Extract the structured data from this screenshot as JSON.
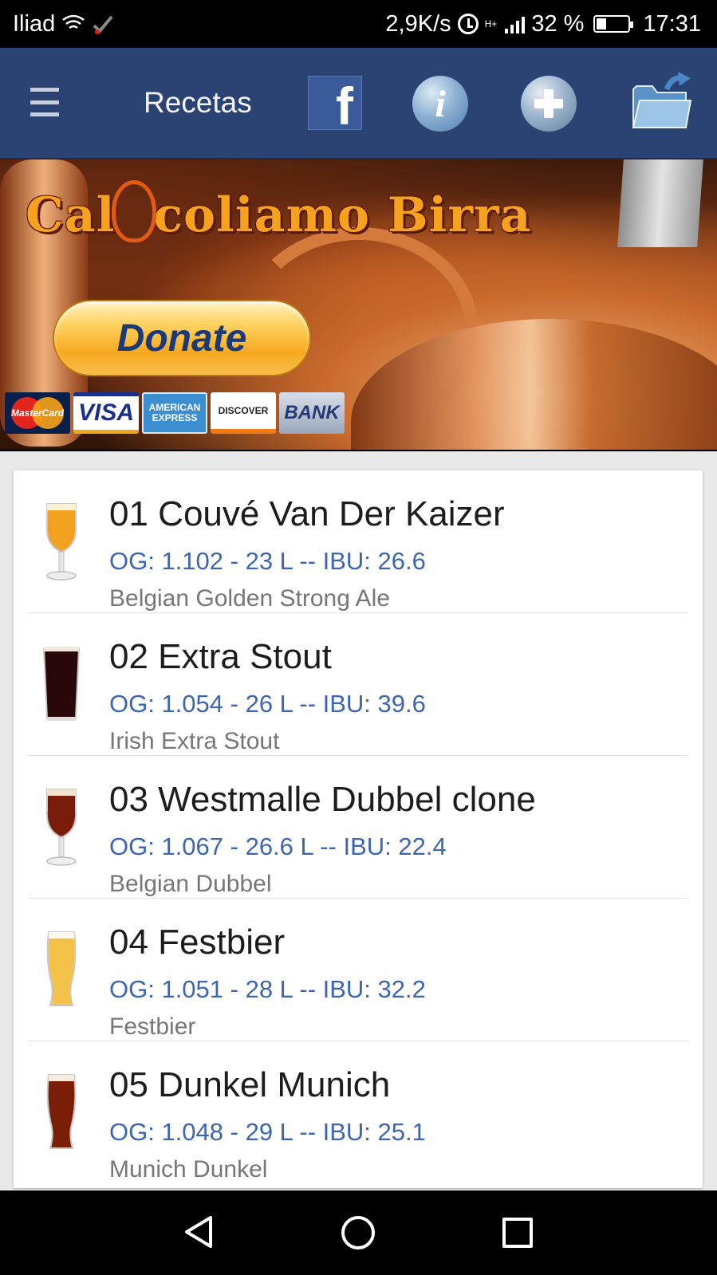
{
  "status_bar": {
    "carrier": "Iliad",
    "network_speed": "2,9K/s",
    "network_type": "H+",
    "battery": "32 %",
    "time": "17:31"
  },
  "app_bar": {
    "title": "Recetas",
    "facebook_glyph": "f",
    "info_glyph": "i"
  },
  "banner": {
    "logo_text": "Cal coliamo Birra",
    "logo_part1": "Cal",
    "logo_part2": "coliamo Birra",
    "donate_label": "Donate",
    "cards": {
      "mastercard": "MasterCard",
      "visa": "VISA",
      "amex": "AMERICAN EXPRESS",
      "discover": "DISCOVER",
      "bank": "BANK"
    }
  },
  "recipes": [
    {
      "name": "01 Couvé Van Der Kaizer",
      "stats": "OG: 1.102 - 23 L -- IBU: 26.6",
      "style": "Belgian Golden Strong Ale",
      "glass": "tulip",
      "color": "#f2a020"
    },
    {
      "name": "02 Extra Stout",
      "stats": "OG: 1.054 - 26 L -- IBU: 39.6",
      "style": "Irish Extra Stout",
      "glass": "pint",
      "color": "#2a0708"
    },
    {
      "name": "03 Westmalle Dubbel clone",
      "stats": "OG: 1.067 - 26.6 L -- IBU: 22.4",
      "style": "Belgian Dubbel",
      "glass": "tulip",
      "color": "#7a1c0a"
    },
    {
      "name": "04 Festbier",
      "stats": "OG: 1.051 - 28 L -- IBU: 32.2",
      "style": "Festbier",
      "glass": "weizen",
      "color": "#f4c248"
    },
    {
      "name": "05 Dunkel Munich",
      "stats": "OG: 1.048 - 29 L -- IBU: 25.1",
      "style": "Munich Dunkel",
      "glass": "weizen",
      "color": "#7a1e08"
    }
  ]
}
